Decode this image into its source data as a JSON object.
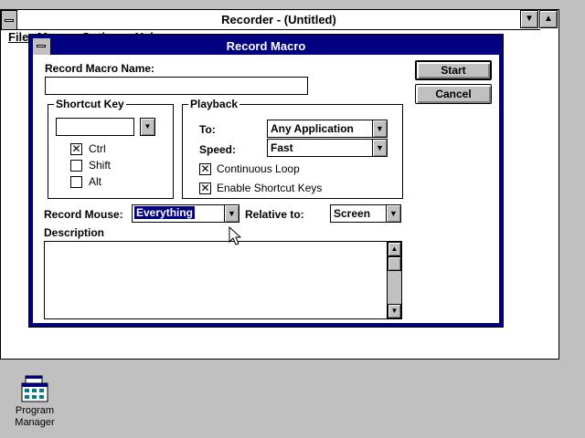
{
  "recorder": {
    "title": "Recorder - (Untitled)",
    "menu": [
      "File",
      "Macro",
      "Options",
      "Help"
    ]
  },
  "dialog": {
    "title": "Record Macro",
    "macro_name_label": "Record Macro Name:",
    "macro_name_value": "",
    "start_label": "Start",
    "cancel_label": "Cancel",
    "shortcut": {
      "group_title": "Shortcut Key",
      "key_value": "",
      "ctrl_label": "Ctrl",
      "ctrl_checked": true,
      "shift_label": "Shift",
      "shift_checked": false,
      "alt_label": "Alt",
      "alt_checked": false
    },
    "playback": {
      "group_title": "Playback",
      "to_label": "To:",
      "to_value": "Any Application",
      "speed_label": "Speed:",
      "speed_value": "Fast",
      "continuous_loop_label": "Continuous Loop",
      "continuous_loop_checked": true,
      "enable_shortcut_label": "Enable Shortcut Keys",
      "enable_shortcut_checked": true
    },
    "record_mouse_label": "Record Mouse:",
    "record_mouse_value": "Everything",
    "relative_to_label": "Relative to:",
    "relative_to_value": "Screen",
    "description_label": "Description",
    "description_value": ""
  },
  "desktop": {
    "program_manager_label": "Program Manager"
  }
}
